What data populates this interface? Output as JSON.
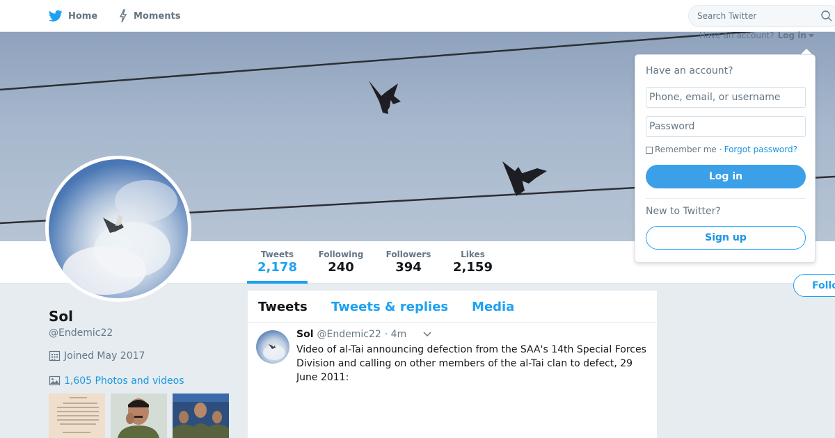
{
  "nav": {
    "home_label": "Home",
    "moments_label": "Moments",
    "search_placeholder": "Search Twitter",
    "have_account_text": "Have an account?",
    "login_link": "Log in"
  },
  "login_dropdown": {
    "title": "Have an account?",
    "username_placeholder": "Phone, email, or username",
    "password_placeholder": "Password",
    "remember_me": "Remember me",
    "separator": "·",
    "forgot_password": "Forgot password?",
    "login_button": "Log in",
    "new_to_twitter": "New to Twitter?",
    "signup_button": "Sign up"
  },
  "profile": {
    "name": "Sol",
    "handle": "@Endemic22",
    "joined": "Joined May 2017",
    "photos_videos": "1,605 Photos and videos",
    "follow_button": "Follow"
  },
  "stats": [
    {
      "label": "Tweets",
      "value": "2,178",
      "active": true
    },
    {
      "label": "Following",
      "value": "240",
      "active": false
    },
    {
      "label": "Followers",
      "value": "394",
      "active": false
    },
    {
      "label": "Likes",
      "value": "2,159",
      "active": false
    }
  ],
  "timeline": {
    "tabs": [
      "Tweets",
      "Tweets & replies",
      "Media"
    ],
    "tweet": {
      "name": "Sol",
      "handle": "@Endemic22",
      "time": "· 4m",
      "text": "Video of al-Tai announcing defection from the SAA's 14th Special Forces Division and calling on other members of the al-Tai clan to defect, 29 June 2011:"
    }
  },
  "colors": {
    "accent": "#1da1f2",
    "link": "#1b95e0",
    "background": "#e6ecf0"
  }
}
